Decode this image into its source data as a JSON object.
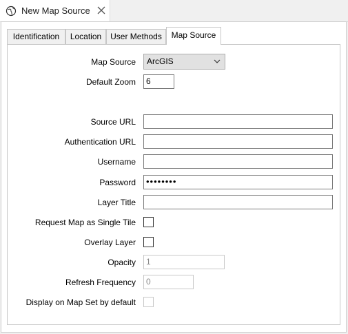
{
  "window": {
    "tab_title": "New Map Source"
  },
  "tabs": [
    {
      "label": "Identification"
    },
    {
      "label": "Location"
    },
    {
      "label": "User Methods"
    },
    {
      "label": "Map Source",
      "active": true
    }
  ],
  "form": {
    "map_source": {
      "label": "Map Source",
      "value": "ArcGIS"
    },
    "default_zoom": {
      "label": "Default Zoom",
      "value": "6"
    },
    "source_url": {
      "label": "Source URL",
      "value": ""
    },
    "auth_url": {
      "label": "Authentication URL",
      "value": ""
    },
    "username": {
      "label": "Username",
      "value": ""
    },
    "password": {
      "label": "Password",
      "value": "••••••••"
    },
    "layer_title": {
      "label": "Layer Title",
      "value": ""
    },
    "single_tile": {
      "label": "Request Map as Single Tile",
      "checked": false
    },
    "overlay_layer": {
      "label": "Overlay Layer",
      "checked": false
    },
    "opacity": {
      "label": "Opacity",
      "value": "1"
    },
    "refresh_frequency": {
      "label": "Refresh Frequency",
      "value": "0"
    },
    "display_default": {
      "label": "Display on Map Set by default",
      "checked": false
    }
  },
  "icons": {
    "tab_icon": "globe-icon",
    "close": "close-icon",
    "dropdown": "chevron-down-icon"
  }
}
